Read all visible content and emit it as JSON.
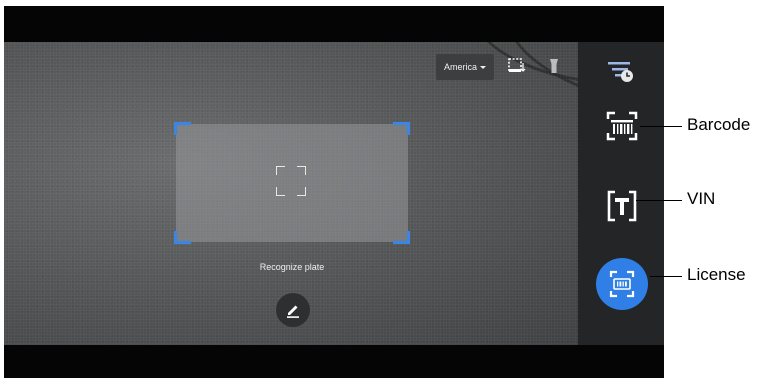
{
  "camera": {
    "region_selector": "America",
    "hint_text": "Recognize plate"
  },
  "toolbar": {
    "icons": [
      "crop-frame-icon",
      "flashlight-icon"
    ]
  },
  "sidebar": {
    "items": [
      {
        "name": "history",
        "icon": "history-list-icon"
      },
      {
        "name": "barcode",
        "icon": "barcode-scan-icon"
      },
      {
        "name": "vin",
        "icon": "text-scan-icon"
      },
      {
        "name": "license",
        "icon": "license-plate-scan-icon",
        "active": true
      }
    ]
  },
  "callouts": {
    "barcode": "Barcode",
    "vin": "VIN",
    "license": "License"
  },
  "colors": {
    "accent": "#2f7fe6",
    "frame_corner": "#3a86e8",
    "sidebar_bg": "#26282a"
  }
}
